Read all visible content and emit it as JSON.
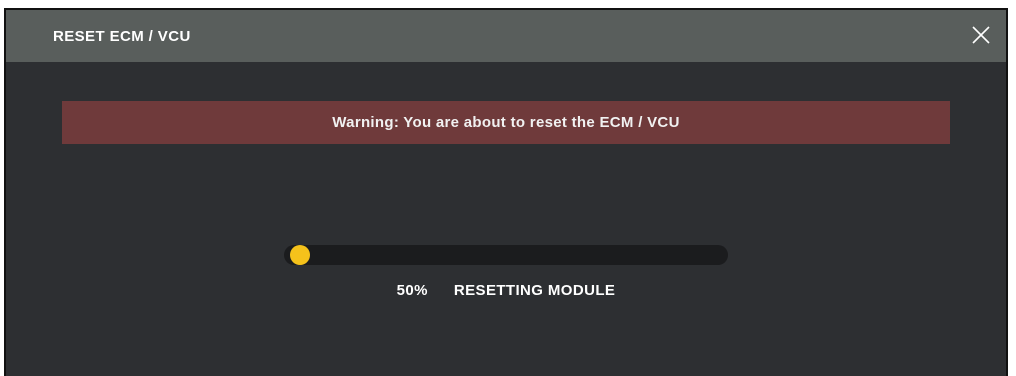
{
  "dialog": {
    "title": "RESET ECM / VCU",
    "close_icon": "close-icon"
  },
  "warning": {
    "text": "Warning: You are about to reset the ECM / VCU",
    "color": "#6f3a3b"
  },
  "progress": {
    "value": 0,
    "percent_label": "50%",
    "status_label": "RESETTING MODULE",
    "track_color": "#1b1c1e",
    "knob_color": "#f5c21b"
  },
  "colors": {
    "titlebar": "#595e5c",
    "body": "#2d2f32"
  }
}
